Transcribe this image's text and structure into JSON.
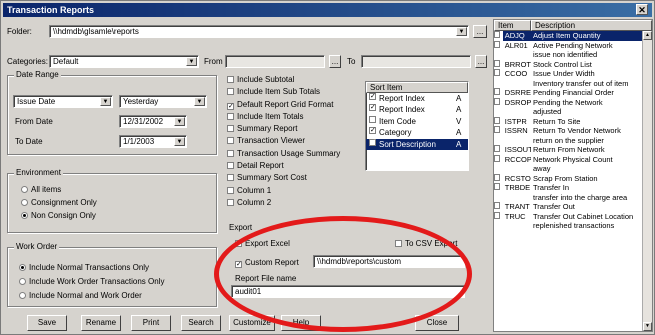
{
  "window": {
    "title": "Transaction Reports",
    "close_glyph": "✕"
  },
  "header": {
    "folder_label": "Folder:",
    "folder_value": "\\\\hdmdb\\glsamle\\reports",
    "category_label": "Categories:",
    "category_value": "Default",
    "from_label": "From",
    "to_label": "To",
    "browse_label": "..."
  },
  "date_range": {
    "title": "Date Range",
    "from_type": "Issue Date",
    "period": "Yesterday",
    "from_date_label": "From Date",
    "from_date_value": "12/31/2002",
    "to_date_label": "To Date",
    "to_date_value": "1/1/2003"
  },
  "environment": {
    "title": "Environment",
    "options": [
      {
        "label": "All items",
        "selected": false
      },
      {
        "label": "Consignment Only",
        "selected": false
      },
      {
        "label": "Non Consign Only",
        "selected": true
      }
    ]
  },
  "work_order": {
    "title": "Work Order",
    "options": [
      {
        "label": "Include Normal Transactions Only",
        "selected": true
      },
      {
        "label": "Include Work Order Transactions Only",
        "selected": false
      },
      {
        "label": "Include Normal and Work Order",
        "selected": false
      }
    ]
  },
  "report_options": [
    {
      "label": "Include Subtotal",
      "checked": false
    },
    {
      "label": "Include Item Sub Totals",
      "checked": false
    },
    {
      "label": "Default Report Grid Format",
      "checked": true
    },
    {
      "label": "Include Item Totals",
      "checked": false
    },
    {
      "label": "Summary Report",
      "checked": false
    },
    {
      "label": "Transaction Viewer",
      "checked": false
    },
    {
      "label": "Transaction Usage Summary",
      "checked": false
    },
    {
      "label": "Detail Report",
      "checked": false
    },
    {
      "label": "Summary Sort Cost",
      "checked": false
    },
    {
      "label": "Column 1",
      "checked": false
    },
    {
      "label": "Column 2",
      "checked": false
    }
  ],
  "sort_list": {
    "header": "Sort Item",
    "items": [
      {
        "label": "Report Index",
        "checked": true,
        "order": "A"
      },
      {
        "label": "Report Index",
        "checked": true,
        "order": "A"
      },
      {
        "label": "Item Code",
        "checked": false,
        "order": "V"
      },
      {
        "label": "Category",
        "checked": true,
        "order": "A"
      },
      {
        "label": "Sort Description",
        "checked": true,
        "order": "A"
      }
    ]
  },
  "export": {
    "title": "Export",
    "export_excel_label": "Export Excel",
    "export_csv_label": "To CSV Export",
    "custom_report_label": "Custom Report",
    "custom_report_checked": true,
    "custom_report_path": "\\\\hdmdb\\reports\\custom",
    "report_file_label": "Report File name",
    "report_file_value": "audit01"
  },
  "buttons": [
    "Save",
    "Rename",
    "Print",
    "Search",
    "Customize",
    "Help",
    "Close"
  ],
  "reports": {
    "columns": [
      "Item",
      "Description"
    ],
    "rows": [
      {
        "code": "ADJQ",
        "desc": "Adjust Item Quantity",
        "selected": true
      },
      {
        "code": "ALR01",
        "desc": "Active Pending Network",
        "selected": false
      },
      {
        "code": "",
        "desc": "issue non identified",
        "selected": false
      },
      {
        "code": "BRROT",
        "desc": "Stock Control List",
        "selected": false
      },
      {
        "code": "CCOO",
        "desc": "Issue Under Width",
        "selected": false
      },
      {
        "code": "",
        "desc": "Inventory transfer out of item",
        "selected": false
      },
      {
        "code": "DSRRE",
        "desc": "Pending Financial Order",
        "selected": false
      },
      {
        "code": "DSROP",
        "desc": "Pending the Network",
        "selected": false
      },
      {
        "code": "",
        "desc": "adjusted",
        "selected": false
      },
      {
        "code": "ISTPR",
        "desc": "Return To Site",
        "selected": false
      },
      {
        "code": "ISSRN",
        "desc": "Return To Vendor Network",
        "selected": false
      },
      {
        "code": "",
        "desc": "return on the supplier",
        "selected": false
      },
      {
        "code": "ISSOUT",
        "desc": "Return From Network",
        "selected": false
      },
      {
        "code": "RCCOP",
        "desc": "Network Physical Count",
        "selected": false
      },
      {
        "code": "",
        "desc": "away",
        "selected": false
      },
      {
        "code": "RCSTO",
        "desc": "Scrap From Station",
        "selected": false
      },
      {
        "code": "TRBDE",
        "desc": "Transfer In",
        "selected": false
      },
      {
        "code": "",
        "desc": "transfer into the charge area",
        "selected": false
      },
      {
        "code": "TRANT",
        "desc": "Transfer Out",
        "selected": false
      },
      {
        "code": "TRUC",
        "desc": "Transfer Out Cabinet Location",
        "selected": false
      },
      {
        "code": "",
        "desc": "replenished transactions",
        "selected": false
      }
    ]
  }
}
